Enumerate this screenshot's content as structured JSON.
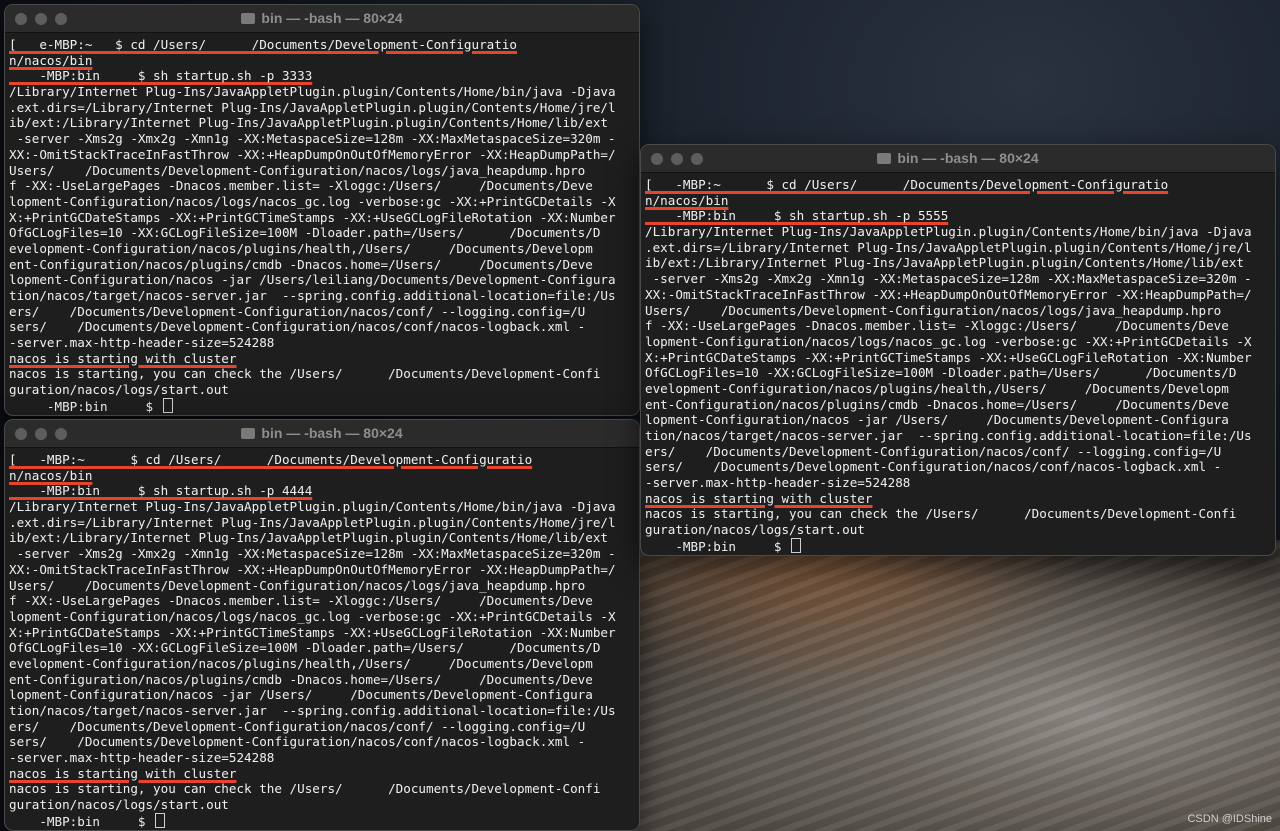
{
  "windows": [
    {
      "title": "bin — -bash — 80×24",
      "lines": [
        "[   e-MBP:~   $ cd /Users/      /Documents/Development-Configuratio",
        "n/nacos/bin",
        "    -MBP:bin     $ sh startup.sh -p 3333",
        "/Library/Internet Plug-Ins/JavaAppletPlugin.plugin/Contents/Home/bin/java -Djava",
        ".ext.dirs=/Library/Internet Plug-Ins/JavaAppletPlugin.plugin/Contents/Home/jre/l",
        "ib/ext:/Library/Internet Plug-Ins/JavaAppletPlugin.plugin/Contents/Home/lib/ext",
        " -server -Xms2g -Xmx2g -Xmn1g -XX:MetaspaceSize=128m -XX:MaxMetaspaceSize=320m -",
        "XX:-OmitStackTraceInFastThrow -XX:+HeapDumpOnOutOfMemoryError -XX:HeapDumpPath=/",
        "Users/    /Documents/Development-Configuration/nacos/logs/java_heapdump.hpro",
        "f -XX:-UseLargePages -Dnacos.member.list= -Xloggc:/Users/     /Documents/Deve",
        "lopment-Configuration/nacos/logs/nacos_gc.log -verbose:gc -XX:+PrintGCDetails -X",
        "X:+PrintGCDateStamps -XX:+PrintGCTimeStamps -XX:+UseGCLogFileRotation -XX:Number",
        "OfGCLogFiles=10 -XX:GCLogFileSize=100M -Dloader.path=/Users/      /Documents/D",
        "evelopment-Configuration/nacos/plugins/health,/Users/     /Documents/Developm",
        "ent-Configuration/nacos/plugins/cmdb -Dnacos.home=/Users/     /Documents/Deve",
        "lopment-Configuration/nacos -jar /Users/leiliang/Documents/Development-Configura",
        "tion/nacos/target/nacos-server.jar  --spring.config.additional-location=file:/Us",
        "ers/    /Documents/Development-Configuration/nacos/conf/ --logging.config=/U",
        "sers/    /Documents/Development-Configuration/nacos/conf/nacos-logback.xml -",
        "-server.max-http-header-size=524288",
        "nacos is starting with cluster",
        "nacos is starting, you can check the /Users/      /Documents/Development-Confi",
        "guration/nacos/logs/start.out",
        "     -MBP:bin     $ "
      ]
    },
    {
      "title": "bin — -bash — 80×24",
      "lines": [
        "[   -MBP:~      $ cd /Users/      /Documents/Development-Configuratio",
        "n/nacos/bin",
        "    -MBP:bin     $ sh startup.sh -p 4444",
        "/Library/Internet Plug-Ins/JavaAppletPlugin.plugin/Contents/Home/bin/java -Djava",
        ".ext.dirs=/Library/Internet Plug-Ins/JavaAppletPlugin.plugin/Contents/Home/jre/l",
        "ib/ext:/Library/Internet Plug-Ins/JavaAppletPlugin.plugin/Contents/Home/lib/ext",
        " -server -Xms2g -Xmx2g -Xmn1g -XX:MetaspaceSize=128m -XX:MaxMetaspaceSize=320m -",
        "XX:-OmitStackTraceInFastThrow -XX:+HeapDumpOnOutOfMemoryError -XX:HeapDumpPath=/",
        "Users/    /Documents/Development-Configuration/nacos/logs/java_heapdump.hpro",
        "f -XX:-UseLargePages -Dnacos.member.list= -Xloggc:/Users/     /Documents/Deve",
        "lopment-Configuration/nacos/logs/nacos_gc.log -verbose:gc -XX:+PrintGCDetails -X",
        "X:+PrintGCDateStamps -XX:+PrintGCTimeStamps -XX:+UseGCLogFileRotation -XX:Number",
        "OfGCLogFiles=10 -XX:GCLogFileSize=100M -Dloader.path=/Users/      /Documents/D",
        "evelopment-Configuration/nacos/plugins/health,/Users/     /Documents/Developm",
        "ent-Configuration/nacos/plugins/cmdb -Dnacos.home=/Users/     /Documents/Deve",
        "lopment-Configuration/nacos -jar /Users/     /Documents/Development-Configura",
        "tion/nacos/target/nacos-server.jar  --spring.config.additional-location=file:/Us",
        "ers/    /Documents/Development-Configuration/nacos/conf/ --logging.config=/U",
        "sers/    /Documents/Development-Configuration/nacos/conf/nacos-logback.xml -",
        "-server.max-http-header-size=524288",
        "nacos is starting with cluster",
        "nacos is starting, you can check the /Users/      /Documents/Development-Confi",
        "guration/nacos/logs/start.out",
        "    -MBP:bin     $ "
      ]
    },
    {
      "title": "bin — -bash — 80×24",
      "lines": [
        "[   -MBP:~      $ cd /Users/      /Documents/Development-Configuratio",
        "n/nacos/bin",
        "    -MBP:bin     $ sh startup.sh -p 5555",
        "/Library/Internet Plug-Ins/JavaAppletPlugin.plugin/Contents/Home/bin/java -Djava",
        ".ext.dirs=/Library/Internet Plug-Ins/JavaAppletPlugin.plugin/Contents/Home/jre/l",
        "ib/ext:/Library/Internet Plug-Ins/JavaAppletPlugin.plugin/Contents/Home/lib/ext",
        " -server -Xms2g -Xmx2g -Xmn1g -XX:MetaspaceSize=128m -XX:MaxMetaspaceSize=320m -",
        "XX:-OmitStackTraceInFastThrow -XX:+HeapDumpOnOutOfMemoryError -XX:HeapDumpPath=/",
        "Users/    /Documents/Development-Configuration/nacos/logs/java_heapdump.hpro",
        "f -XX:-UseLargePages -Dnacos.member.list= -Xloggc:/Users/     /Documents/Deve",
        "lopment-Configuration/nacos/logs/nacos_gc.log -verbose:gc -XX:+PrintGCDetails -X",
        "X:+PrintGCDateStamps -XX:+PrintGCTimeStamps -XX:+UseGCLogFileRotation -XX:Number",
        "OfGCLogFiles=10 -XX:GCLogFileSize=100M -Dloader.path=/Users/      /Documents/D",
        "evelopment-Configuration/nacos/plugins/health,/Users/     /Documents/Developm",
        "ent-Configuration/nacos/plugins/cmdb -Dnacos.home=/Users/     /Documents/Deve",
        "lopment-Configuration/nacos -jar /Users/     /Documents/Development-Configura",
        "tion/nacos/target/nacos-server.jar  --spring.config.additional-location=file:/Us",
        "ers/    /Documents/Development-Configuration/nacos/conf/ --logging.config=/U",
        "sers/    /Documents/Development-Configuration/nacos/conf/nacos-logback.xml -",
        "-server.max-http-header-size=524288",
        "nacos is starting with cluster",
        "nacos is starting, you can check the /Users/      /Documents/Development-Confi",
        "guration/nacos/logs/start.out",
        "    -MBP:bin     $ "
      ]
    }
  ],
  "colors": {
    "highlight": "#e8432d",
    "terminal_bg": "#1e1e1e",
    "text": "#f0f0f0"
  },
  "watermark": "CSDN @IDShine"
}
